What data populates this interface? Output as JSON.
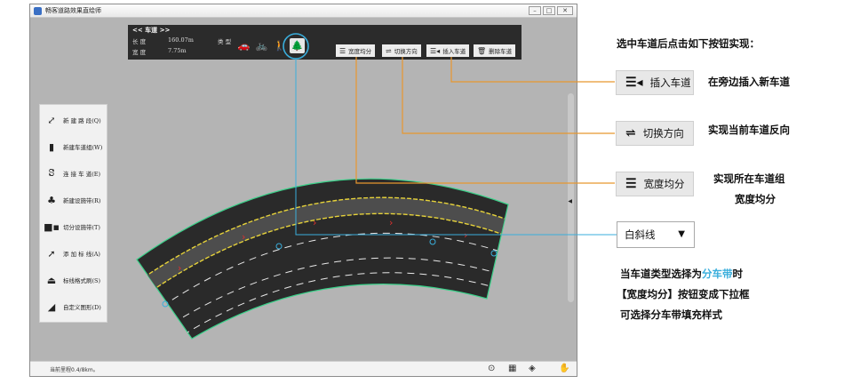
{
  "window": {
    "title": "畅客道路效果直绘师",
    "controls": {
      "minimize": "–",
      "maximize": "□",
      "close": "✕"
    }
  },
  "lane_panel": {
    "title": "<< 车道 >>",
    "length_label": "长 度",
    "length_value": "160.07m",
    "width_label": "宽 度",
    "width_value": "7.75m",
    "type_label": "类 型",
    "type_icons": [
      "car-icon",
      "bicycle-icon",
      "pedestrian-icon",
      "tree-icon"
    ],
    "selected_type_icon": "tree-icon",
    "buttons": [
      {
        "icon": "☰",
        "label": "宽度均分"
      },
      {
        "icon": "⇌",
        "label": "切换方向"
      },
      {
        "icon": "☰◂",
        "label": "插入车道"
      },
      {
        "icon": "🗑",
        "label": "删除车道"
      }
    ]
  },
  "toolbar": [
    {
      "icon": "new-road-icon",
      "label": "新 建 路 段(Q)"
    },
    {
      "icon": "lane-group-icon",
      "label": "新建车道组(W)"
    },
    {
      "icon": "connect-lane-icon",
      "label": "连 接 车 道(E)"
    },
    {
      "icon": "facility-strip-icon",
      "label": "新建设施带(R)"
    },
    {
      "icon": "split-strip-icon",
      "label": "切分设施带(T)"
    },
    {
      "icon": "add-marking-icon",
      "label": "添 加 标 线(A)"
    },
    {
      "icon": "marking-brush-icon",
      "label": "标线格式刷(S)"
    },
    {
      "icon": "custom-shape-icon",
      "label": "自定义图形(D)"
    }
  ],
  "status": {
    "text": "当前里程0.4/8km。"
  },
  "annotations": {
    "heading": "选中车道后点击如下按钮实现：",
    "insert_btn": "插入车道",
    "insert_desc": "在旁边插入新车道",
    "switch_btn": "切换方向",
    "switch_desc": "实现当前车道反向",
    "equal_btn": "宽度均分",
    "equal_desc_1": "实现所在车道组",
    "equal_desc_2": "宽度均分",
    "dropdown_value": "白斜线",
    "note_1_pre": "当车道类型选择为",
    "note_1_accent": "分车带",
    "note_1_post": "时",
    "note_2": "【宽度均分】按钮变成下拉框",
    "note_3": "可选择分车带填充样式"
  },
  "colors": {
    "accent": "#3aaedc",
    "callout_line": "#e8962e",
    "road": "#2a2a2a",
    "road_edge": "#3bd18a",
    "yellow_marking": "#e6d23a",
    "lane_arrow": "#e0302e"
  }
}
